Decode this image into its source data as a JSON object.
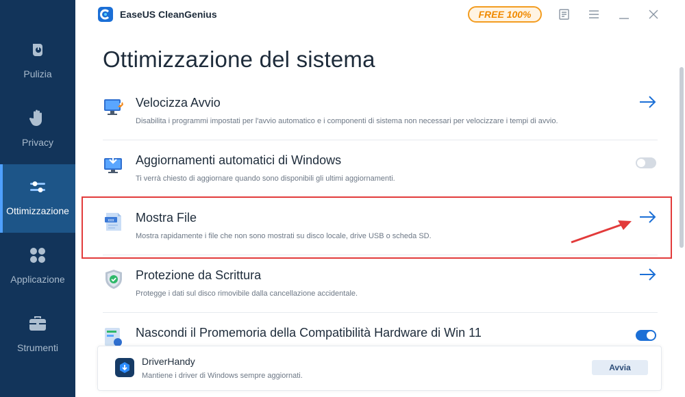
{
  "app": {
    "title": "EaseUS CleanGenius",
    "badge": "FREE 100%"
  },
  "colors": {
    "sidebar_bg": "#12345a",
    "sidebar_active": "#1d5588",
    "accent": "#1b6fd6",
    "badge": "#f39c1f",
    "highlight": "#e23a3a"
  },
  "sidebar": {
    "items": [
      {
        "label": "Pulizia",
        "icon": "broom-icon",
        "active": false
      },
      {
        "label": "Privacy",
        "icon": "hand-icon",
        "active": false
      },
      {
        "label": "Ottimizzazione",
        "icon": "sliders-icon",
        "active": true
      },
      {
        "label": "Applicazione",
        "icon": "apps-grid-icon",
        "active": false
      },
      {
        "label": "Strumenti",
        "icon": "toolbox-icon",
        "active": false
      }
    ]
  },
  "page": {
    "title": "Ottimizzazione del sistema"
  },
  "items": [
    {
      "title": "Velocizza Avvio",
      "desc": "Disabilita i programmi impostati per l'avvio automatico e i componenti di sistema non necessari per velocizzare i tempi di avvio.",
      "control": "arrow",
      "icon": "monitor-rocket-icon"
    },
    {
      "title": "Aggiornamenti automatici di Windows",
      "desc": "Ti verrà chiesto di aggiornare quando sono disponibili gli ultimi aggiornamenti.",
      "control": "toggle",
      "toggle_on": false,
      "icon": "monitor-update-icon"
    },
    {
      "title": "Mostra File",
      "desc": "Mostra rapidamente i file che non sono mostrati su disco locale, drive USB o scheda SD.",
      "control": "arrow",
      "icon": "file-icon"
    },
    {
      "title": "Protezione da Scrittura",
      "desc": "Protegge i dati sul disco rimovibile dalla cancellazione accidentale.",
      "control": "arrow",
      "icon": "shield-check-icon"
    },
    {
      "title": "Nascondi il Promemoria della Compatibilità Hardware di Win 11",
      "desc": "",
      "control": "toggle",
      "toggle_on": true,
      "icon": "compatibility-icon"
    }
  ],
  "bottom_card": {
    "title": "DriverHandy",
    "desc": "Mantiene i driver di Windows sempre aggiornati.",
    "button": "Avvia"
  }
}
